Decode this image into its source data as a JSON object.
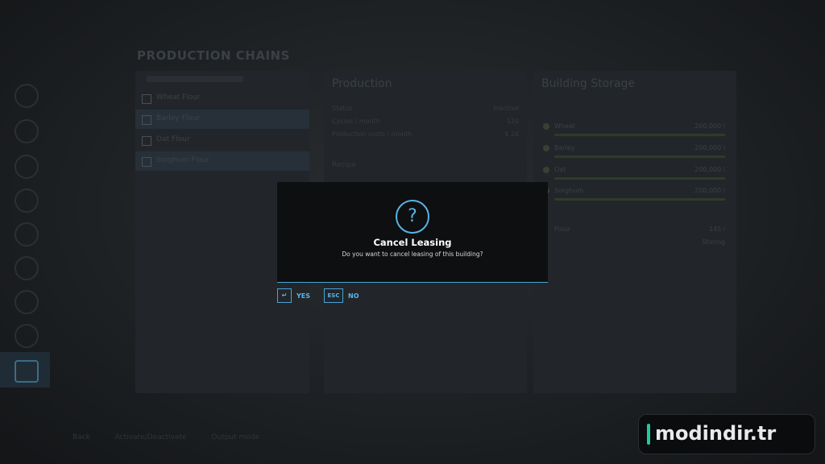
{
  "background": {
    "page_title": "PRODUCTION CHAINS",
    "chains": [
      "Wheat Flour",
      "Barley Flour",
      "Oat Flour",
      "Sorghum Flour"
    ],
    "production_heading": "Production",
    "production_rows": [
      {
        "label": "Status",
        "value": "Inactive"
      },
      {
        "label": "Cycles / month",
        "value": "120"
      },
      {
        "label": "Production costs / month",
        "value": "$ 24"
      }
    ],
    "recipe_label": "Recipe",
    "storage_heading": "Building Storage",
    "storage_items": [
      {
        "name": "Wheat",
        "value": "200,000 l"
      },
      {
        "name": "Barley",
        "value": "200,000 l"
      },
      {
        "name": "Oat",
        "value": "200,000 l"
      },
      {
        "name": "Sorghum",
        "value": "200,000 l"
      }
    ],
    "storage_extra": [
      {
        "name": "Flour",
        "value": "145 l"
      },
      {
        "name": "",
        "value": "Storing"
      }
    ],
    "footer": [
      "Back",
      "Activate/Deactivate",
      "Output mode"
    ]
  },
  "dialog": {
    "icon": "question-icon",
    "icon_glyph": "?",
    "title": "Cancel Leasing",
    "message": "Do you want to cancel leasing of this building?"
  },
  "buttons": {
    "yes": {
      "key": "↵",
      "label": "YES"
    },
    "no": {
      "key": "ESC",
      "label": "NO"
    }
  },
  "watermark": {
    "text": "modindir.tr",
    "accent": "#20c9a0"
  },
  "colors": {
    "accent": "#5ab3e6"
  }
}
